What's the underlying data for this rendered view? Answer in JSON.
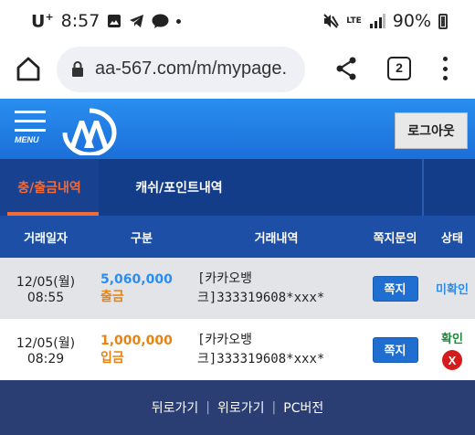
{
  "status_bar": {
    "carrier": "U",
    "carrier_sup": "+",
    "time": "8:57",
    "network": "LTE",
    "battery": "90%"
  },
  "browser": {
    "url": "aa-567.com/m/mypage.",
    "tab_count": "2"
  },
  "header": {
    "menu_label": "MENU",
    "logout_label": "로그아웃"
  },
  "tabs": [
    {
      "label": "충/출금내역"
    },
    {
      "label": "캐쉬/포인트내역"
    }
  ],
  "table": {
    "columns": [
      "거래일자",
      "구분",
      "거래내역",
      "쪽지문의",
      "상태"
    ],
    "rows": [
      {
        "date": "12/05(월)",
        "time": "08:55",
        "amount": "5,060,000",
        "type": "출금",
        "desc_line1": "[카카오뱅",
        "desc_line2": "크]333319608*xxx*",
        "memo_label": "쪽지",
        "status": "미확인"
      },
      {
        "date": "12/05(월)",
        "time": "08:29",
        "amount": "1,000,000",
        "type": "입금",
        "desc_line1": "[카카오뱅",
        "desc_line2": "크]333319608*xxx*",
        "memo_label": "쪽지",
        "status": "확인",
        "delete_label": "X"
      }
    ]
  },
  "footer": {
    "back": "뒤로가기",
    "top": "위로가기",
    "pc": "PC버전",
    "separator": "|"
  },
  "colors": {
    "header_blue": "#2a8ef0",
    "tab_bar": "#133c89",
    "active_tab": "#f06a3a",
    "withdraw": "#2a8ef0",
    "deposit": "#e8830f",
    "confirmed": "#1a8a3a",
    "delete": "#d41c1c"
  }
}
